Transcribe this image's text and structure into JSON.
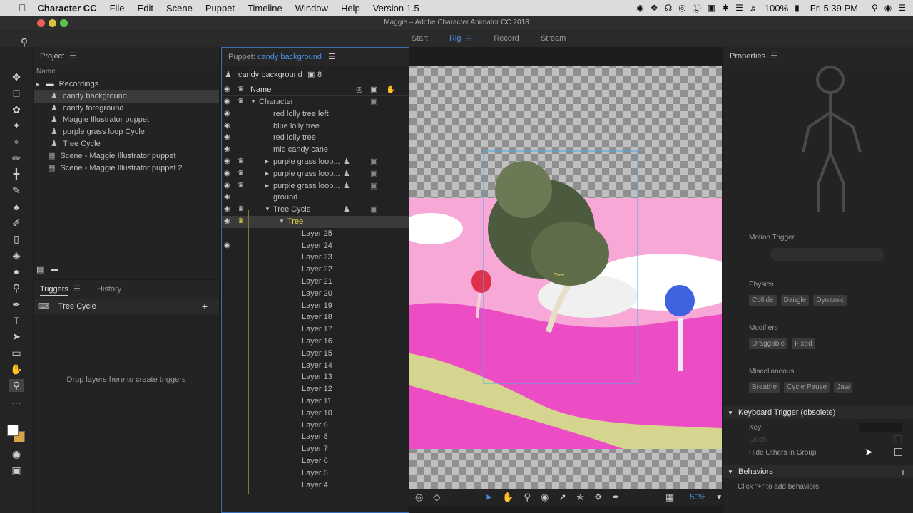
{
  "menubar": {
    "apple": "",
    "app": "Character CC",
    "items": [
      "File",
      "Edit",
      "Scene",
      "Puppet",
      "Timeline",
      "Window",
      "Help",
      "Version 1.5"
    ],
    "battery": "100%",
    "clock": "Fri 5:39 PM"
  },
  "window": {
    "title": "Maggie – Adobe Character Animator CC 2018"
  },
  "modes": [
    {
      "label": "Start"
    },
    {
      "label": "Rig"
    },
    {
      "label": "Record"
    },
    {
      "label": "Stream"
    }
  ],
  "project": {
    "title": "Project",
    "col_name": "Name",
    "items": [
      "Recordings",
      "candy background",
      "candy foreground",
      "Maggie Illustrator puppet",
      "purple grass loop Cycle",
      "Tree Cycle",
      "Scene - Maggie Illustrator puppet",
      "Scene - Maggie Illustrator puppet 2"
    ]
  },
  "triggers": {
    "tab1": "Triggers",
    "tab2": "History",
    "item": "Tree Cycle",
    "empty": "Drop layers here to create triggers"
  },
  "puppet": {
    "label": "Puppet:",
    "name": "candy background",
    "puppet_row": "candy background",
    "count": "8",
    "col_name": "Name",
    "layers": [
      {
        "n": "Character"
      },
      {
        "n": "red lolly tree left"
      },
      {
        "n": "blue lolly tree"
      },
      {
        "n": "red lolly tree"
      },
      {
        "n": "mid candy cane"
      },
      {
        "n": "purple grass loop..."
      },
      {
        "n": "purple grass loop..."
      },
      {
        "n": "purple grass loop..."
      },
      {
        "n": "ground"
      },
      {
        "n": "Tree Cycle"
      },
      {
        "n": "Tree"
      },
      {
        "n": "Layer 25"
      },
      {
        "n": "Layer 24"
      },
      {
        "n": "Layer 23"
      },
      {
        "n": "Layer 22"
      },
      {
        "n": "Layer 21"
      },
      {
        "n": "Layer 20"
      },
      {
        "n": "Layer 19"
      },
      {
        "n": "Layer 18"
      },
      {
        "n": "Layer 17"
      },
      {
        "n": "Layer 16"
      },
      {
        "n": "Layer 15"
      },
      {
        "n": "Layer 14"
      },
      {
        "n": "Layer 13"
      },
      {
        "n": "Layer 12"
      },
      {
        "n": "Layer 11"
      },
      {
        "n": "Layer 10"
      },
      {
        "n": "Layer 9"
      },
      {
        "n": "Layer 8"
      },
      {
        "n": "Layer 7"
      },
      {
        "n": "Layer 6"
      },
      {
        "n": "Layer 5"
      },
      {
        "n": "Layer 4"
      }
    ]
  },
  "canvas": {
    "zoom": "50%",
    "tree_label": "Tree"
  },
  "properties": {
    "title": "Properties",
    "motion": "Motion Trigger",
    "physics": "Physics",
    "physics_btns": [
      "Collide",
      "Dangle",
      "Dynamic"
    ],
    "modifiers": "Modifiers",
    "mod_btns": [
      "Draggable",
      "Fixed"
    ],
    "misc": "Miscellaneous",
    "misc_btns": [
      "Breathe",
      "Cycle Pause",
      "Jaw"
    ],
    "kbd": "Keyboard Trigger (obsolete)",
    "key": "Key",
    "latch": "Latch",
    "hide": "Hide Others in Group",
    "behaviors": "Behaviors",
    "behaviors_hint": "Click \"+\" to add behaviors."
  },
  "colors": {
    "accent": "#4a90e2",
    "pink": "#f7a8d6",
    "magenta": "#ec4dc4",
    "grass": "#d6d58f"
  }
}
